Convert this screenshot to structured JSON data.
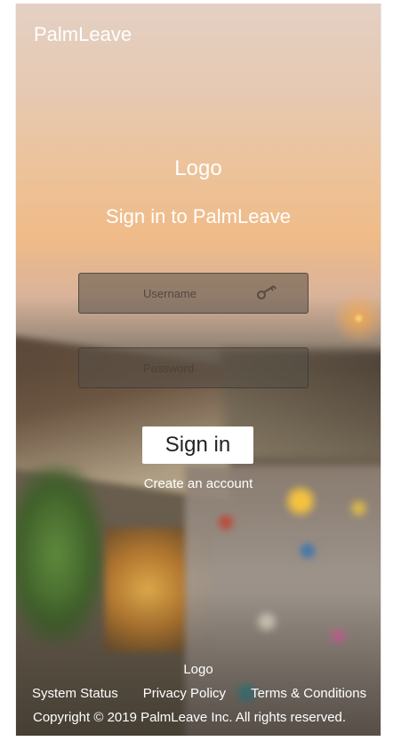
{
  "header": {
    "brand": "PalmLeave"
  },
  "main": {
    "logo": "Logo",
    "heading": "Sign in to PalmLeave",
    "username": {
      "placeholder": "Username",
      "value": ""
    },
    "password": {
      "placeholder": "Password",
      "value": ""
    },
    "signin_label": "Sign in",
    "create_account": "Create an account",
    "key_icon": "key-icon"
  },
  "footer": {
    "logo": "Logo",
    "links": [
      "System Status",
      "Privacy Policy",
      "Terms & Conditions"
    ],
    "copyright": "Copyright © 2019 PalmLeave Inc. All rights reserved."
  },
  "colors": {
    "text": "#ffffff",
    "button_bg": "#ffffff",
    "button_text": "#222222",
    "field_bg": "rgba(85,78,70,0.55)"
  }
}
